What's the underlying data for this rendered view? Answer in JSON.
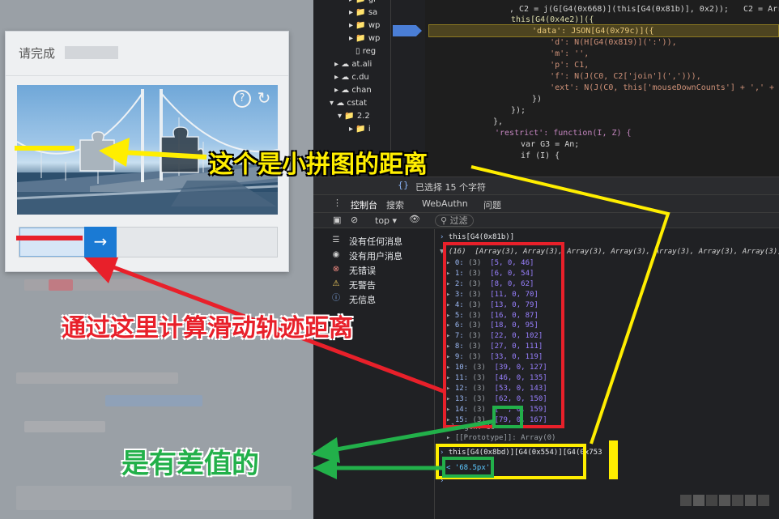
{
  "captcha": {
    "title": "请完成",
    "help_icon": "?",
    "refresh_icon": "↻",
    "slider_arrow": "→"
  },
  "file_tree": {
    "items": [
      "gr",
      "sa",
      "wp",
      "wp",
      "reg",
      "at.ali",
      "c.du",
      "chan",
      "cstat",
      "2.2",
      "i"
    ]
  },
  "code": {
    "lines": [
      ", C2 = j(G[G4(0x668)](this[G4(0x81b)], 0x2));   C2 = Array(47)",
      "this[G4(0x4e2)]({",
      "  'data': JSON[G4(0x79c)]({",
      "    'd': N(H[G4(0x819)](':')),",
      "    'm': '',",
      "    'p': C1,",
      "    'f': N(J(C0, C2['join'](','))),",
      "    'ext': N(J(C0, this['mouseDownCounts'] + ',' + this[G4(0x730)",
      "  })",
      "});",
      "},",
      "'restrict': function(I, Z) {",
      "  var G3 = An;",
      "  if (I) {"
    ]
  },
  "status_bar": {
    "selected_text": "已选择 15 个字符"
  },
  "tabs": [
    "控制台",
    "搜索",
    "WebAuthn",
    "问题"
  ],
  "toolbar": {
    "context": "top",
    "filter_placeholder": "过滤"
  },
  "sidebar": {
    "items": [
      {
        "label": "没有任何消息",
        "icon": "list-icon"
      },
      {
        "label": "没有用户消息",
        "icon": "user-icon"
      },
      {
        "label": "无错误",
        "icon": "error-icon"
      },
      {
        "label": "无警告",
        "icon": "warning-icon"
      },
      {
        "label": "无信息",
        "icon": "info-icon"
      }
    ]
  },
  "console": {
    "expr1": "this[G4(0x81b)]",
    "array_summary": "(16)  [Array(3), Array(3), Array(3), Array(3), Array(3), Array(3), Array(3), Array(3), Array(3), Array",
    "rows": [
      {
        "i": "0:",
        "v": "[5, 0, 46]"
      },
      {
        "i": "1:",
        "v": "[6, 0, 54]"
      },
      {
        "i": "2:",
        "v": "[8, 0, 62]"
      },
      {
        "i": "3:",
        "v": "[11, 0, 70]"
      },
      {
        "i": "4:",
        "v": "[13, 0, 79]"
      },
      {
        "i": "5:",
        "v": "[16, 0, 87]"
      },
      {
        "i": "6:",
        "v": "[18, 0, 95]"
      },
      {
        "i": "7:",
        "v": "[22, 0, 102]"
      },
      {
        "i": "8:",
        "v": "[27, 0, 111]"
      },
      {
        "i": "9:",
        "v": "[33, 0, 119]"
      },
      {
        "i": "10:",
        "v": "[39, 0, 127]"
      },
      {
        "i": "11:",
        "v": "[46, 0, 135]"
      },
      {
        "i": "12:",
        "v": "[53, 0, 143]"
      },
      {
        "i": "13:",
        "v": "[62, 0, 150]"
      },
      {
        "i": "14:",
        "v": "[  , 0, 159]"
      },
      {
        "i": "15:",
        "v": "[79, 0, 167]"
      }
    ],
    "length_row": "length: 16",
    "prototype_row": "[[Prototype]]: Array(0)",
    "expr2": "this[G4(0x8bd)][G4(0x554)][G4(0x753",
    "result2": "'68.5px'"
  },
  "annotations": {
    "yellow_label": "这个是小拼图的距离",
    "red_label": "通过这里计算滑动轨迹距离",
    "green_label": "是有差值的",
    "yellow_color": "#ffee00",
    "red_color": "#e8202a",
    "green_color": "#22b04a"
  }
}
